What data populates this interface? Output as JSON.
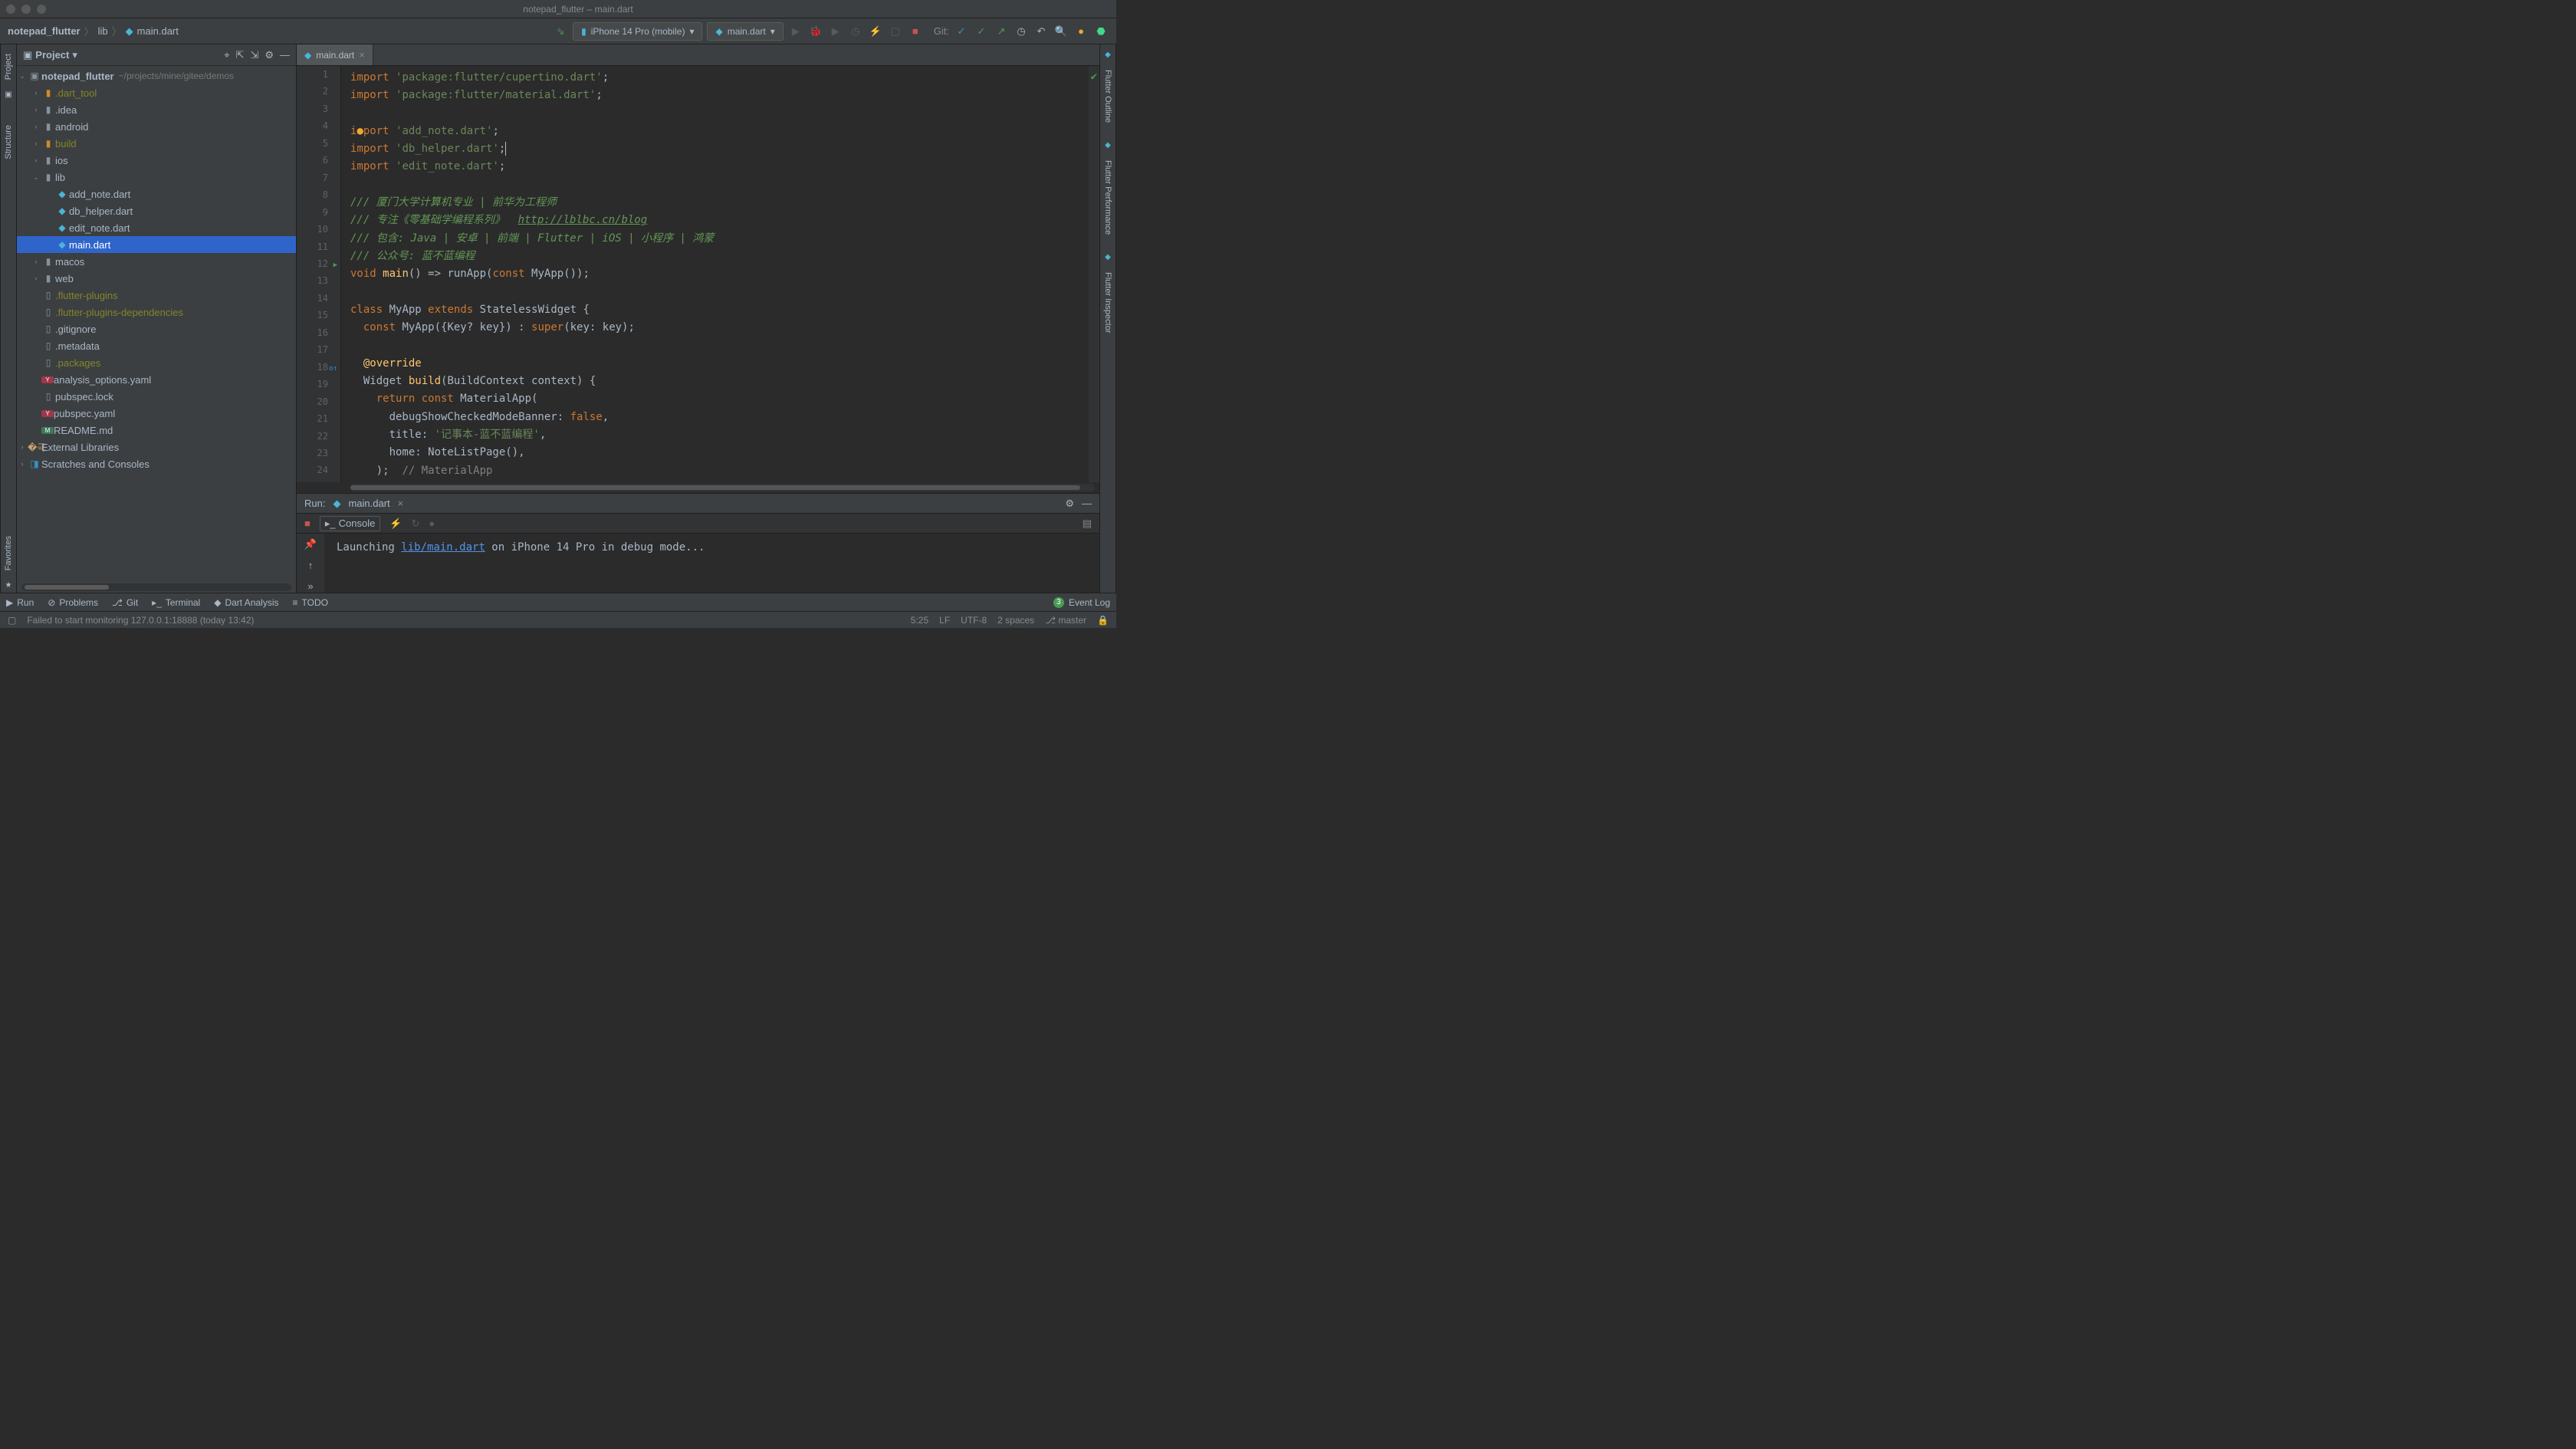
{
  "window": {
    "title": "notepad_flutter – main.dart"
  },
  "breadcrumbs": {
    "project": "notepad_flutter",
    "folder": "lib",
    "file": "main.dart"
  },
  "device": {
    "label": "iPhone 14 Pro (mobile)"
  },
  "run_config": {
    "label": "main.dart"
  },
  "git_label": "Git:",
  "project_panel": {
    "title": "Project",
    "root": {
      "name": "notepad_flutter",
      "path": "~/projects/mine/gitee/demos"
    },
    "items": [
      {
        "name": ".dart_tool",
        "type": "folder-ex",
        "indent": 1,
        "arrow": "›"
      },
      {
        "name": ".idea",
        "type": "folder-idea",
        "indent": 1,
        "arrow": "›"
      },
      {
        "name": "android",
        "type": "folder",
        "indent": 1,
        "arrow": "›"
      },
      {
        "name": "build",
        "type": "folder-ex",
        "indent": 1,
        "arrow": "›"
      },
      {
        "name": "ios",
        "type": "folder",
        "indent": 1,
        "arrow": "›"
      },
      {
        "name": "lib",
        "type": "folder",
        "indent": 1,
        "arrow": "⌄"
      },
      {
        "name": "add_note.dart",
        "type": "dart",
        "indent": 2
      },
      {
        "name": "db_helper.dart",
        "type": "dart",
        "indent": 2
      },
      {
        "name": "edit_note.dart",
        "type": "dart",
        "indent": 2
      },
      {
        "name": "main.dart",
        "type": "dart",
        "indent": 2,
        "selected": true
      },
      {
        "name": "macos",
        "type": "folder",
        "indent": 1,
        "arrow": "›"
      },
      {
        "name": "web",
        "type": "folder",
        "indent": 1,
        "arrow": "›"
      },
      {
        "name": ".flutter-plugins",
        "type": "file-ex",
        "indent": 1
      },
      {
        "name": ".flutter-plugins-dependencies",
        "type": "file-ex",
        "indent": 1
      },
      {
        "name": ".gitignore",
        "type": "file",
        "indent": 1
      },
      {
        "name": ".metadata",
        "type": "file",
        "indent": 1
      },
      {
        "name": ".packages",
        "type": "file-ex",
        "indent": 1
      },
      {
        "name": "analysis_options.yaml",
        "type": "yaml",
        "indent": 1
      },
      {
        "name": "pubspec.lock",
        "type": "file",
        "indent": 1
      },
      {
        "name": "pubspec.yaml",
        "type": "yaml",
        "indent": 1
      },
      {
        "name": "README.md",
        "type": "md",
        "indent": 1
      }
    ],
    "ext_libs": "External Libraries",
    "scratches": "Scratches and Consoles"
  },
  "editor": {
    "tab": "main.dart",
    "lines": [
      {
        "n": 1,
        "html": "<span class='kw'>import</span> <span class='str'>'package:flutter/cupertino.dart'</span>;"
      },
      {
        "n": 2,
        "html": "<span class='kw'>import</span> <span class='str'>'package:flutter/material.dart'</span>;"
      },
      {
        "n": 3,
        "html": ""
      },
      {
        "n": 4,
        "mark": "bulb",
        "html": "<span class='kw'>i<span class='warn-bulb'>●</span>port</span> <span class='str'>'add_note.dart'</span>;"
      },
      {
        "n": 5,
        "html": "<span class='kw'>import</span> <span class='str'>'db_helper.dart'</span>;<span class='caret'></span>"
      },
      {
        "n": 6,
        "html": "<span class='kw'>import</span> <span class='str'>'edit_note.dart'</span>;"
      },
      {
        "n": 7,
        "html": ""
      },
      {
        "n": 8,
        "html": "<span class='doccom'>/// 厦门大学计算机专业 | 前华为工程师</span>"
      },
      {
        "n": 9,
        "html": "<span class='doccom'>/// 专注《零基础学编程系列》  <span class='doclink'>http://lblbc.cn/blog</span></span>"
      },
      {
        "n": 10,
        "html": "<span class='doccom'>/// 包含: Java | 安卓 | 前端 | Flutter | iOS | 小程序 | 鸿蒙</span>"
      },
      {
        "n": 11,
        "html": "<span class='doccom'>/// 公众号: 蓝不蓝编程</span>"
      },
      {
        "n": 12,
        "mark": "run",
        "html": "<span class='kw'>void</span> <span class='fn'>main</span>() => runApp(<span class='kw'>const</span> MyApp());"
      },
      {
        "n": 13,
        "html": ""
      },
      {
        "n": 14,
        "html": "<span class='kw'>class</span> MyApp <span class='kw'>extends</span> StatelessWidget {"
      },
      {
        "n": 15,
        "html": "  <span class='kw'>const</span> MyApp({Key? key}) : <span class='kw'>super</span>(key: key);"
      },
      {
        "n": 16,
        "html": ""
      },
      {
        "n": 17,
        "html": "  <span class='fn'>@override</span>"
      },
      {
        "n": 18,
        "mark": "override",
        "html": "  Widget <span class='fn'>build</span>(BuildContext context) {"
      },
      {
        "n": 19,
        "html": "    <span class='kw'>return const</span> MaterialApp("
      },
      {
        "n": 20,
        "html": "      debugShowCheckedModeBanner: <span class='bool'>false</span>,"
      },
      {
        "n": 21,
        "html": "      title: <span class='str'>'记事本-蓝不蓝编程'</span>,"
      },
      {
        "n": 22,
        "html": "      home: NoteListPage(),"
      },
      {
        "n": 23,
        "html": "    );  <span class='com'>// MaterialApp</span>"
      },
      {
        "n": 24,
        "html": ""
      }
    ]
  },
  "left_tabs": {
    "project": "Project",
    "structure": "Structure",
    "favorites": "Favorites"
  },
  "right_tabs": {
    "outline": "Flutter Outline",
    "perf": "Flutter Performance",
    "inspector": "Flutter Inspector"
  },
  "run": {
    "label": "Run:",
    "config": "main.dart",
    "console_tab": "Console",
    "output_pre": "Launching ",
    "output_link": "lib/main.dart",
    "output_post": " on iPhone 14 Pro in debug mode..."
  },
  "bottom": {
    "run": "Run",
    "problems": "Problems",
    "git": "Git",
    "terminal": "Terminal",
    "dart": "Dart Analysis",
    "todo": "TODO",
    "event_log": "Event Log",
    "event_count": "3"
  },
  "status": {
    "msg": "Failed to start monitoring 127.0.0.1:18888 (today 13:42)",
    "pos": "5:25",
    "lf": "LF",
    "enc": "UTF-8",
    "indent": "2 spaces",
    "branch": "master"
  }
}
